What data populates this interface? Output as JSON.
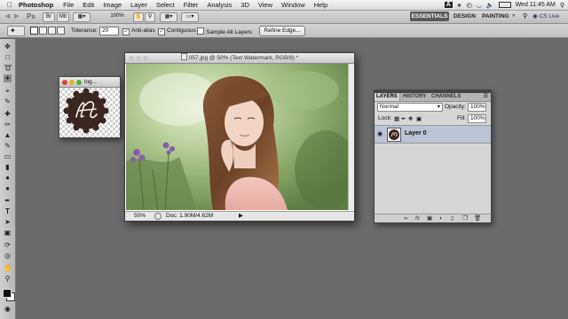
{
  "menubar": {
    "app_name": "Photoshop",
    "items": [
      "File",
      "Edit",
      "Image",
      "Layer",
      "Select",
      "Filter",
      "Analysis",
      "3D",
      "View",
      "Window",
      "Help"
    ],
    "clock": "Wed 11:45 AM"
  },
  "appbar": {
    "ps_label": "Ps",
    "zoom": "100%",
    "workspaces": {
      "essentials": "ESSENTIALS",
      "design": "DESIGN",
      "painting": "PAINTING",
      "more": "»"
    },
    "cs_live": "CS Live"
  },
  "options": {
    "tolerance_label": "Tolerance:",
    "tolerance_value": "20",
    "anti_alias": "Anti-alias",
    "anti_alias_checked": true,
    "contiguous": "Contiguous",
    "contiguous_checked": true,
    "sample_all_layers": "Sample All Layers",
    "sample_all_layers_checked": false,
    "refine_edge": "Refine Edge..."
  },
  "logo_window": {
    "title": "log..."
  },
  "document": {
    "title": "057.jpg @ 50% (Text Watermark, RGB/8) *",
    "zoom": "50%",
    "doc_info": "Doc: 1.90M/4.62M"
  },
  "layers_panel": {
    "tabs": [
      "LAYERS",
      "HISTORY",
      "CHANNELS"
    ],
    "blend_mode": "Normal",
    "opacity_label": "Opacity:",
    "opacity_value": "100%",
    "lock_label": "Lock:",
    "fill_label": "Fill:",
    "fill_value": "100%",
    "layer_name": "Layer 0",
    "bottom_icons": [
      "link",
      "fx",
      "mask",
      "adjustment",
      "group",
      "new-layer",
      "trash"
    ]
  },
  "colors": {
    "workspace_bg": "#6b6b6b",
    "active_workspace": "#5a5a5a",
    "selected_layer": "#b9c4d4",
    "logo_badge": "#3a2620"
  }
}
